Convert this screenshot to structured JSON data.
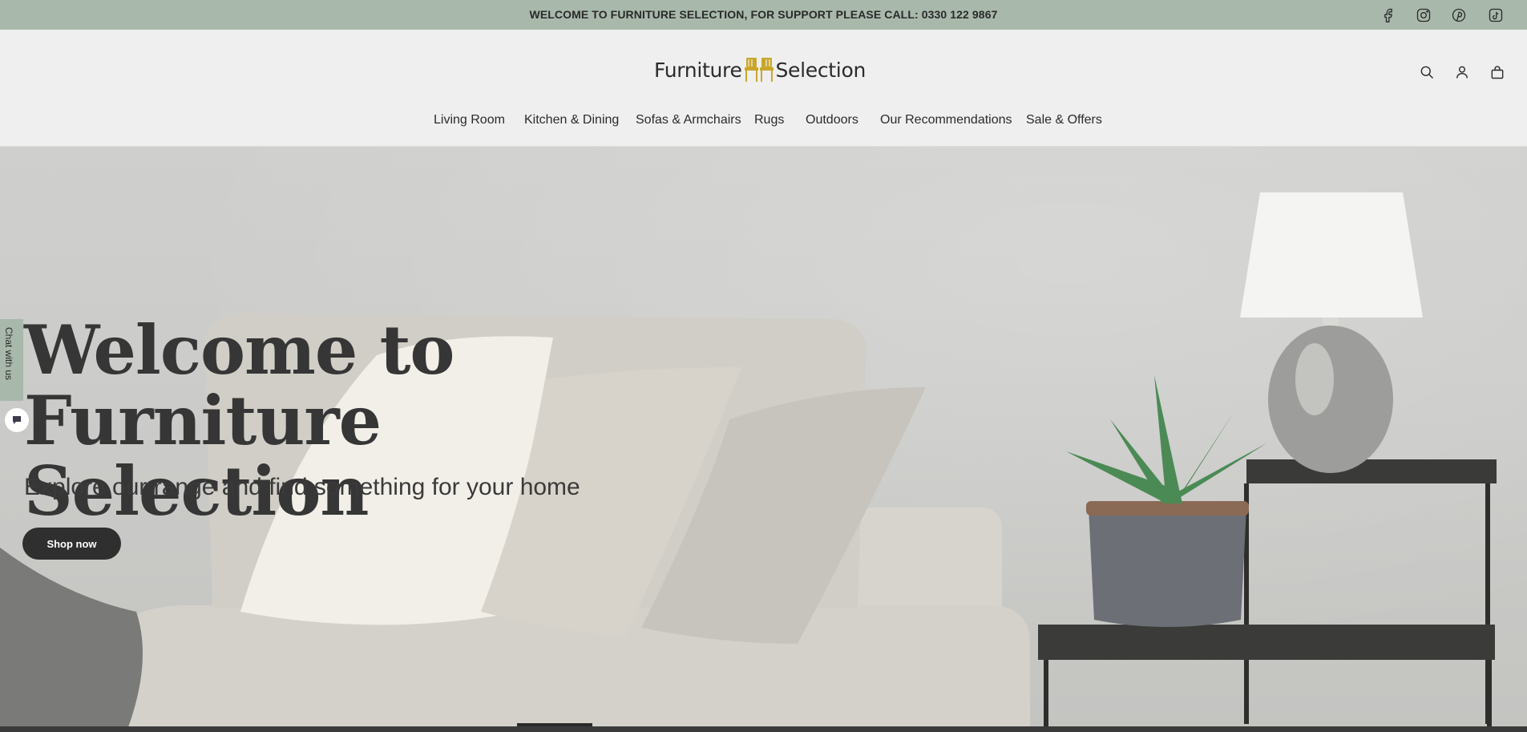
{
  "announcement": {
    "text": "WELCOME TO FURNITURE SELECTION, FOR SUPPORT PLEASE CALL: 0330 122 9867",
    "social": [
      "facebook-icon",
      "instagram-icon",
      "pinterest-icon",
      "tiktok-icon"
    ]
  },
  "brand": {
    "word1": "Furniture",
    "word2": "Selection",
    "accent": "#c9a62a"
  },
  "header_icons": [
    "search-icon",
    "account-icon",
    "cart-icon"
  ],
  "nav": [
    {
      "label": "Living Room"
    },
    {
      "label": "Kitchen & Dining"
    },
    {
      "label": "Sofas & Armchairs"
    },
    {
      "label": "Rugs"
    },
    {
      "label": "Outdoors"
    },
    {
      "label": "Our Recommendations"
    },
    {
      "label": "Sale & Offers"
    }
  ],
  "hero": {
    "title_line1": "Welcome to",
    "title_line2": "Furniture Selection",
    "subtitle": "Explore our range and find something for your home",
    "cta": "Shop now"
  },
  "chat": {
    "label": "Chat with us"
  },
  "colors": {
    "announcement_bg": "#a8b9ab",
    "page_bg": "#efefef",
    "button_bg": "#2f2f2f"
  }
}
